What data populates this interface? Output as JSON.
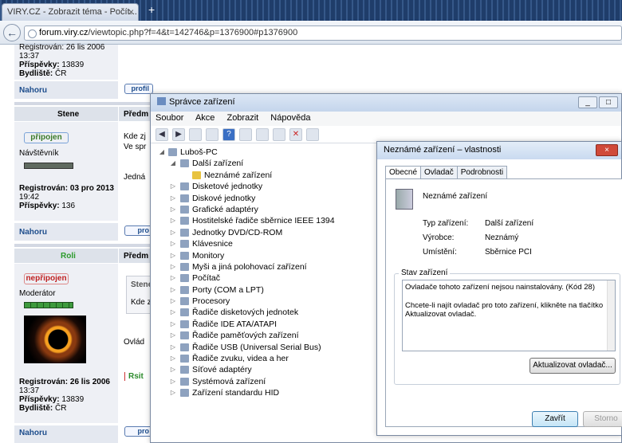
{
  "browser": {
    "tab_title": "VIRY.CZ - Zobrazit téma - Počít...",
    "tab_close": "×",
    "new_tab": "+",
    "back": "←",
    "url_host": "forum.viry.cz",
    "url_path": "/viewtopic.php?f=4&t=142746&p=1376900#p1376900"
  },
  "forum": {
    "top": {
      "registered_value": "Registrován: 26 lis 2006",
      "registered_time": "13:37",
      "posts_label": "Příspěvky:",
      "posts_value": "13839",
      "location_label": "Bydliště:",
      "location_value": "ČR"
    },
    "back_link": "Nahoru",
    "profile_button": "profil",
    "post_header_stub": "Předm",
    "user2": {
      "name": "Stene",
      "status": "připojen",
      "rank": "Návštěvník",
      "registered_value": "Registrován: 03 pro 2013",
      "registered_time": "19:42",
      "posts_label": "Příspěvky:",
      "posts_value": "136"
    },
    "user2_text1": "Kde zj",
    "user2_text2": "Ve spr",
    "user2_text3": "Jedná",
    "user3": {
      "name": "Roli",
      "status": "nepřipojen",
      "rank": "Moderátor",
      "registered_value": "Registrován: 26 lis 2006",
      "registered_time": "13:37",
      "posts_label": "Příspěvky:",
      "posts_value": "13839",
      "location_label": "Bydliště:",
      "location_value": "ČR"
    },
    "quote_head": "Stene",
    "quote_text": "Kde z",
    "user3_text": "Ovlád",
    "reply_stub": "Rsit",
    "profile_button_stub": "pro"
  },
  "device_manager": {
    "title": "Správce zařízení",
    "menu": [
      "Soubor",
      "Akce",
      "Zobrazit",
      "Nápověda"
    ],
    "root": "Luboš-PC",
    "other_devices": "Další zařízení",
    "unknown_device": "Neznámé zařízení",
    "categories": [
      "Disketové jednotky",
      "Diskové jednotky",
      "Grafické adaptéry",
      "Hostitelské řadiče sběrnice IEEE 1394",
      "Jednotky DVD/CD-ROM",
      "Klávesnice",
      "Monitory",
      "Myši a jiná polohovací zařízení",
      "Počítač",
      "Porty (COM a LPT)",
      "Procesory",
      "Řadiče disketových jednotek",
      "Řadiče IDE ATA/ATAPI",
      "Řadiče paměťových zařízení",
      "Řadiče USB (Universal Serial Bus)",
      "Řadiče zvuku, videa a her",
      "Síťové adaptéry",
      "Systémová zařízení",
      "Zařízení standardu HID"
    ]
  },
  "props": {
    "title": "Neznámé zařízení – vlastnosti",
    "close": "×",
    "tabs": [
      "Obecné",
      "Ovladač",
      "Podrobnosti"
    ],
    "device_name": "Neznámé zařízení",
    "type_label": "Typ zařízení:",
    "type_value": "Další zařízení",
    "maker_label": "Výrobce:",
    "maker_value": "Neznámý",
    "location_label": "Umístění:",
    "location_value": "Sběrnice PCI",
    "status_label": "Stav zařízení",
    "status_line1": "Ovladače tohoto zařízení nejsou nainstalovány. (Kód 28)",
    "status_line2": "Chcete-li najít ovladač pro toto zařízení, klikněte na tlačítko Aktualizovat ovladač.",
    "update_button": "Aktualizovat ovladač...",
    "ok_button": "Zavřít",
    "cancel_button": "Storno"
  }
}
